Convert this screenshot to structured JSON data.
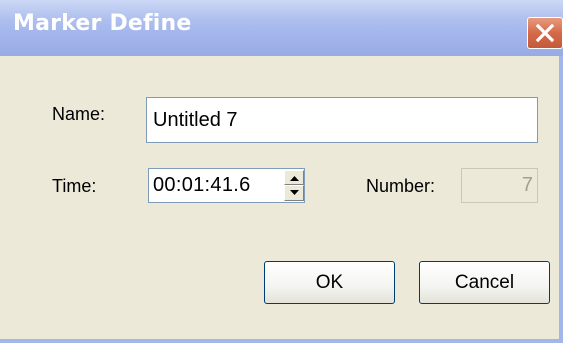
{
  "window": {
    "title": "Marker Define",
    "close_icon": "close-icon"
  },
  "fields": {
    "name_label": "Name:",
    "name_value": "Untitled 7",
    "time_label": "Time:",
    "time_value": "00:01:41.6",
    "number_label": "Number:",
    "number_value": "7"
  },
  "buttons": {
    "ok": "OK",
    "cancel": "Cancel"
  },
  "icons": {
    "spin_up": "spin-up-icon",
    "spin_down": "spin-down-icon"
  },
  "colors": {
    "dialog_bg": "#ece9d8",
    "titlebar": "#a3b6ec",
    "close_red": "#d46a4a",
    "field_border": "#7f9db9"
  }
}
